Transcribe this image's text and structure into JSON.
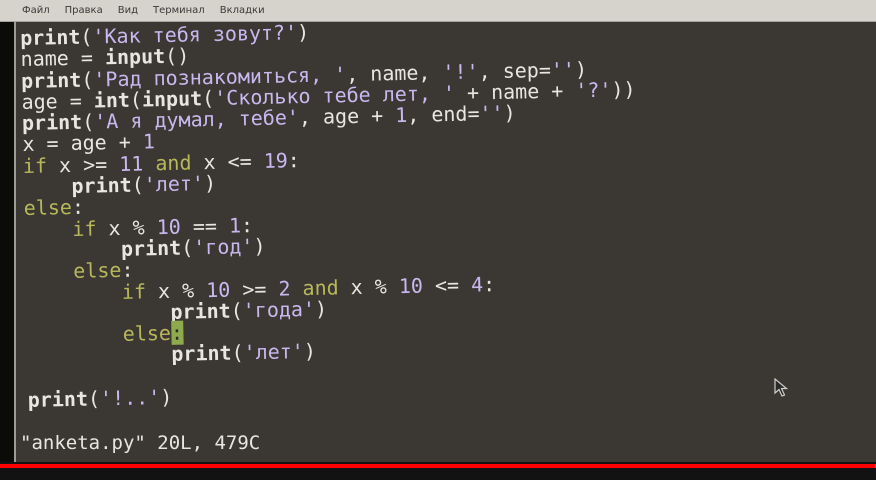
{
  "menubar": {
    "items": [
      "Файл",
      "Правка",
      "Вид",
      "Терминал",
      "Вкладки"
    ]
  },
  "code_lines": [
    [
      {
        "t": "fn",
        "v": "print"
      },
      {
        "t": "plain",
        "v": "("
      },
      {
        "t": "str",
        "v": "'Как тебя зовут?'"
      },
      {
        "t": "plain",
        "v": ")"
      }
    ],
    [
      {
        "t": "plain",
        "v": "name = "
      },
      {
        "t": "fn",
        "v": "input"
      },
      {
        "t": "plain",
        "v": "()"
      }
    ],
    [
      {
        "t": "fn",
        "v": "print"
      },
      {
        "t": "plain",
        "v": "("
      },
      {
        "t": "str",
        "v": "'Рад познакомиться, '"
      },
      {
        "t": "plain",
        "v": ", name, "
      },
      {
        "t": "str",
        "v": "'!'"
      },
      {
        "t": "plain",
        "v": ", sep="
      },
      {
        "t": "str",
        "v": "''"
      },
      {
        "t": "plain",
        "v": ")"
      }
    ],
    [
      {
        "t": "plain",
        "v": "age = "
      },
      {
        "t": "fn",
        "v": "int"
      },
      {
        "t": "plain",
        "v": "("
      },
      {
        "t": "fn",
        "v": "input"
      },
      {
        "t": "plain",
        "v": "("
      },
      {
        "t": "str",
        "v": "'Сколько тебе лет, '"
      },
      {
        "t": "plain",
        "v": " + name + "
      },
      {
        "t": "str",
        "v": "'?'"
      },
      {
        "t": "plain",
        "v": "))"
      }
    ],
    [
      {
        "t": "fn",
        "v": "print"
      },
      {
        "t": "plain",
        "v": "("
      },
      {
        "t": "str",
        "v": "'А я думал, тебе'"
      },
      {
        "t": "plain",
        "v": ", age + "
      },
      {
        "t": "num",
        "v": "1"
      },
      {
        "t": "plain",
        "v": ", end="
      },
      {
        "t": "str",
        "v": "''"
      },
      {
        "t": "plain",
        "v": ")"
      }
    ],
    [
      {
        "t": "plain",
        "v": "x = age + "
      },
      {
        "t": "num",
        "v": "1"
      }
    ],
    [
      {
        "t": "kw",
        "v": "if"
      },
      {
        "t": "plain",
        "v": " x >= "
      },
      {
        "t": "num",
        "v": "11"
      },
      {
        "t": "plain",
        "v": " "
      },
      {
        "t": "kw",
        "v": "and"
      },
      {
        "t": "plain",
        "v": " x <= "
      },
      {
        "t": "num",
        "v": "19"
      },
      {
        "t": "plain",
        "v": ":"
      }
    ],
    [
      {
        "t": "plain",
        "v": "    "
      },
      {
        "t": "fn",
        "v": "print"
      },
      {
        "t": "plain",
        "v": "("
      },
      {
        "t": "str",
        "v": "'лет'"
      },
      {
        "t": "plain",
        "v": ")"
      }
    ],
    [
      {
        "t": "kw",
        "v": "else"
      },
      {
        "t": "plain",
        "v": ":"
      }
    ],
    [
      {
        "t": "plain",
        "v": "    "
      },
      {
        "t": "kw",
        "v": "if"
      },
      {
        "t": "plain",
        "v": " x % "
      },
      {
        "t": "num",
        "v": "10"
      },
      {
        "t": "plain",
        "v": " == "
      },
      {
        "t": "num",
        "v": "1"
      },
      {
        "t": "plain",
        "v": ":"
      }
    ],
    [
      {
        "t": "plain",
        "v": "        "
      },
      {
        "t": "fn",
        "v": "print"
      },
      {
        "t": "plain",
        "v": "("
      },
      {
        "t": "str",
        "v": "'год'"
      },
      {
        "t": "plain",
        "v": ")"
      }
    ],
    [
      {
        "t": "plain",
        "v": "    "
      },
      {
        "t": "kw",
        "v": "else"
      },
      {
        "t": "plain",
        "v": ":"
      }
    ],
    [
      {
        "t": "plain",
        "v": "        "
      },
      {
        "t": "kw",
        "v": "if"
      },
      {
        "t": "plain",
        "v": " x % "
      },
      {
        "t": "num",
        "v": "10"
      },
      {
        "t": "plain",
        "v": " >= "
      },
      {
        "t": "num",
        "v": "2"
      },
      {
        "t": "plain",
        "v": " "
      },
      {
        "t": "kw",
        "v": "and"
      },
      {
        "t": "plain",
        "v": " x % "
      },
      {
        "t": "num",
        "v": "10"
      },
      {
        "t": "plain",
        "v": " <= "
      },
      {
        "t": "num",
        "v": "4"
      },
      {
        "t": "plain",
        "v": ":"
      }
    ],
    [
      {
        "t": "plain",
        "v": "            "
      },
      {
        "t": "fn",
        "v": "print"
      },
      {
        "t": "plain",
        "v": "("
      },
      {
        "t": "str",
        "v": "'года'"
      },
      {
        "t": "plain",
        "v": ")"
      }
    ],
    [
      {
        "t": "plain",
        "v": "        "
      },
      {
        "t": "kw",
        "v": "else"
      },
      {
        "t": "cursor",
        "v": ":"
      }
    ],
    [
      {
        "t": "plain",
        "v": "            "
      },
      {
        "t": "fn",
        "v": "print"
      },
      {
        "t": "plain",
        "v": "("
      },
      {
        "t": "str",
        "v": "'лет'"
      },
      {
        "t": "plain",
        "v": ")"
      }
    ],
    [],
    [
      {
        "t": "fn",
        "v": "print"
      },
      {
        "t": "plain",
        "v": "("
      },
      {
        "t": "str",
        "v": "'!..'"
      },
      {
        "t": "plain",
        "v": ")"
      }
    ]
  ],
  "status_line": "\"anketa.py\" 20L, 479C",
  "video_progress": 0.999,
  "pointer_icon": "mouse-pointer-icon",
  "colors": {
    "background": "#3b3834",
    "keyword": "#b8b85a",
    "string": "#c9b8ee",
    "text": "#e8e6e1",
    "cursor": "#8dab4e",
    "progress": "#ff0000"
  }
}
